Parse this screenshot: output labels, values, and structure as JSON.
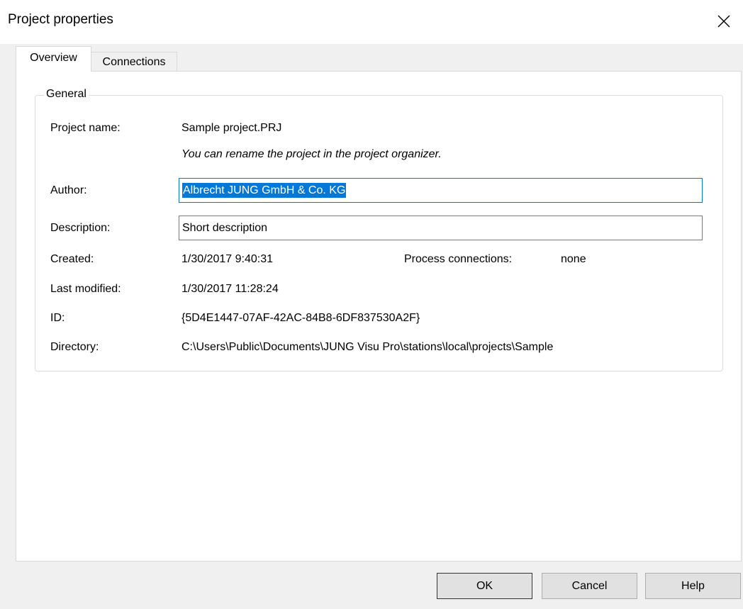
{
  "window": {
    "title": "Project properties"
  },
  "tabs": [
    {
      "label": "Overview",
      "active": true
    },
    {
      "label": "Connections",
      "active": false
    }
  ],
  "general": {
    "legend": "General",
    "project_name_label": "Project name:",
    "project_name_value": "Sample project.PRJ",
    "rename_hint": "You can rename the project in the project organizer.",
    "author_label": "Author:",
    "author_value": "Albrecht JUNG GmbH & Co. KG",
    "description_label": "Description:",
    "description_value": "Short description",
    "created_label": "Created:",
    "created_value": "1/30/2017 9:40:31",
    "process_connections_label": "Process connections:",
    "process_connections_value": "none",
    "last_modified_label": "Last modified:",
    "last_modified_value": "1/30/2017 11:28:24",
    "id_label": "ID:",
    "id_value": "{5D4E1447-07AF-42AC-84B8-6DF837530A2F}",
    "directory_label": "Directory:",
    "directory_value": "C:\\Users\\Public\\Documents\\JUNG Visu Pro\\stations\\local\\projects\\Sample"
  },
  "buttons": {
    "ok": "OK",
    "cancel": "Cancel",
    "help": "Help"
  },
  "colors": {
    "selection": "#0078d7",
    "focus_border": "#0078d7",
    "dialog_bg": "#f0f0f0"
  }
}
